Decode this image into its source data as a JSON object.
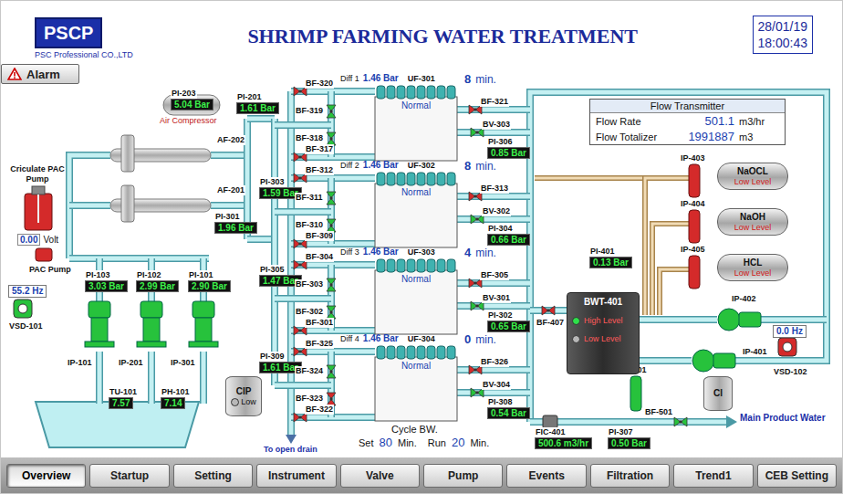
{
  "header": {
    "logo": "PSCP",
    "company": "PSC Professional CO.,LTD",
    "title": "SHRIMP FARMING WATER TREATMENT",
    "date": "28/01/19",
    "time": "18:00:43"
  },
  "alarm_button": {
    "label": "Alarm"
  },
  "air_compressor": {
    "label": "Air Compressor"
  },
  "gauges": [
    {
      "tag": "PI-203",
      "value": "5.04 Bar"
    },
    {
      "tag": "PI-201",
      "value": "1.61 Bar"
    },
    {
      "tag": "PI-303",
      "value": "1.59 Bar"
    },
    {
      "tag": "PI-301",
      "value": "1.96 Bar"
    },
    {
      "tag": "PI-305",
      "value": "1.47 Bar"
    },
    {
      "tag": "PI-309",
      "value": "1.61 Bar"
    },
    {
      "tag": "PI-103",
      "value": "3.03 Bar"
    },
    {
      "tag": "PI-102",
      "value": "2.99 Bar"
    },
    {
      "tag": "PI-101",
      "value": "2.90 Bar"
    },
    {
      "tag": "PI-401",
      "value": "0.13 Bar"
    },
    {
      "tag": "PI-307",
      "value": "0.50 Bar"
    },
    {
      "tag": "TU-101",
      "value": "7.57"
    },
    {
      "tag": "PH-101",
      "value": "7.14"
    },
    {
      "tag": "FIC-401",
      "value": "500.6 m3/hr"
    }
  ],
  "filters": [
    {
      "tag": "AF-202"
    },
    {
      "tag": "AF-201"
    }
  ],
  "pac": {
    "title": "Criculate PAC Pump",
    "value": "0.00",
    "unit": "Volt",
    "pump_label": "PAC Pump",
    "running": false
  },
  "vsds": [
    {
      "tag": "VSD-101",
      "value": "55.2 Hz",
      "running": true
    },
    {
      "tag": "VSD-102",
      "value": "0.0 Hz",
      "running": false
    }
  ],
  "pumps": [
    {
      "tag": "IP-101",
      "kind": "multistage",
      "running": true
    },
    {
      "tag": "IP-201",
      "kind": "multistage",
      "running": true
    },
    {
      "tag": "IP-301",
      "kind": "multistage",
      "running": true
    },
    {
      "tag": "IP-402",
      "kind": "centrifugal",
      "running": true
    },
    {
      "tag": "IP-401",
      "kind": "centrifugal",
      "running": true
    },
    {
      "tag": "IP-501",
      "kind": "dosing",
      "running": true
    }
  ],
  "uf_units": [
    {
      "tag": "UF-301",
      "diff_label": "Diff 1",
      "diff_value": "1.46 Bar",
      "status": "Normal",
      "timer": "8",
      "timer_unit": "min.",
      "valves": [
        {
          "tag": "BF-320",
          "open": false
        },
        {
          "tag": "BF-319",
          "open": true
        },
        {
          "tag": "BF-318",
          "open": true
        },
        {
          "tag": "BF-317",
          "open": false
        },
        {
          "tag": "BF-321",
          "open": false
        },
        {
          "tag": "BV-303",
          "open": true
        }
      ],
      "outlet_gauge": {
        "tag": "PI-306",
        "value": "0.85 Bar"
      }
    },
    {
      "tag": "UF-302",
      "diff_label": "Diff 2",
      "diff_value": "1.46 Bar",
      "status": "Normal",
      "timer": "8",
      "timer_unit": "min.",
      "valves": [
        {
          "tag": "BF-312",
          "open": false
        },
        {
          "tag": "BF-311",
          "open": true
        },
        {
          "tag": "BF-310",
          "open": true
        },
        {
          "tag": "BF-309",
          "open": false
        },
        {
          "tag": "BF-313",
          "open": false
        },
        {
          "tag": "BV-302",
          "open": true
        }
      ],
      "outlet_gauge": {
        "tag": "PI-304",
        "value": "0.66 Bar"
      }
    },
    {
      "tag": "UF-303",
      "diff_label": "Diff 3",
      "diff_value": "1.46 Bar",
      "status": "Normal",
      "timer": "4",
      "timer_unit": "min.",
      "valves": [
        {
          "tag": "BF-304",
          "open": false
        },
        {
          "tag": "BF-303",
          "open": true
        },
        {
          "tag": "BF-302",
          "open": true
        },
        {
          "tag": "BF-301",
          "open": false
        },
        {
          "tag": "BF-305",
          "open": false
        },
        {
          "tag": "BV-301",
          "open": true
        }
      ],
      "outlet_gauge": {
        "tag": "PI-302",
        "value": "0.65 Bar"
      }
    },
    {
      "tag": "UF-304",
      "diff_label": "Diff 4",
      "diff_value": "1.46 Bar",
      "status": "Normal",
      "timer": "0",
      "timer_unit": "min.",
      "valves": [
        {
          "tag": "BF-325",
          "open": false
        },
        {
          "tag": "BF-324",
          "open": true
        },
        {
          "tag": "BF-323",
          "open": false
        },
        {
          "tag": "BF-322",
          "open": false
        },
        {
          "tag": "BF-326",
          "open": false
        },
        {
          "tag": "BV-304",
          "open": true
        }
      ],
      "outlet_gauge": {
        "tag": "PI-308",
        "value": "0.54 Bar"
      }
    }
  ],
  "valves": [
    {
      "tag": "BF-407",
      "open": false
    },
    {
      "tag": "BF-501",
      "open": true
    }
  ],
  "dosing": [
    {
      "pump": "IP-403",
      "running": false,
      "chemical": "NaOCL",
      "alarm": "Low Level"
    },
    {
      "pump": "IP-404",
      "running": false,
      "chemical": "NaOH",
      "alarm": "Low Level"
    },
    {
      "pump": "IP-405",
      "running": false,
      "chemical": "HCL",
      "alarm": "Low Level"
    }
  ],
  "cip_tank": {
    "label": "CIP",
    "level": "Low",
    "level_on": false
  },
  "cl_tank": {
    "label": "Cl"
  },
  "bwt_tank": {
    "tag": "BWT-401",
    "switches": [
      {
        "label": "High Level",
        "on": true
      },
      {
        "label": "Low Level",
        "on": false
      }
    ]
  },
  "flow_transmitter": {
    "title": "Flow Transmitter",
    "rows": [
      {
        "label": "Flow Rate",
        "value": "501.1",
        "unit": "m3/hr"
      },
      {
        "label": "Flow Totalizer",
        "value": "1991887",
        "unit": "m3"
      }
    ]
  },
  "cycle_bw": {
    "title": "Cycle BW.",
    "set_label": "Set",
    "set_value": "80",
    "set_unit": "Min.",
    "run_label": "Run",
    "run_value": "20",
    "run_unit": "Min."
  },
  "drain_label": "To open drain",
  "product_label": "Main Product Water",
  "nav": [
    {
      "label": "Overview",
      "selected": true
    },
    {
      "label": "Startup",
      "selected": false
    },
    {
      "label": "Setting",
      "selected": false
    },
    {
      "label": "Instrument",
      "selected": false
    },
    {
      "label": "Valve",
      "selected": false
    },
    {
      "label": "Pump",
      "selected": false
    },
    {
      "label": "Events",
      "selected": false
    },
    {
      "label": "Filtration",
      "selected": false
    },
    {
      "label": "Trend1",
      "selected": false
    },
    {
      "label": "CEB Setting",
      "selected": false
    }
  ]
}
